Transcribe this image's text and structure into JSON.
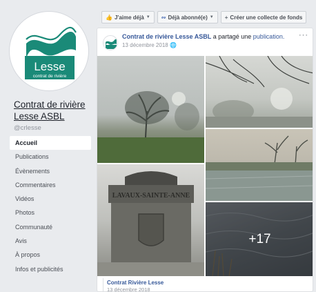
{
  "page": {
    "logo_text": "Lesse",
    "logo_subtext": "contrat de rivière",
    "name": "Contrat de rivière Lesse ASBL",
    "handle": "@crlesse"
  },
  "nav": {
    "items": [
      {
        "label": "Accueil",
        "active": true
      },
      {
        "label": "Publications"
      },
      {
        "label": "Évènements"
      },
      {
        "label": "Commentaires"
      },
      {
        "label": "Vidéos"
      },
      {
        "label": "Photos"
      },
      {
        "label": "Communauté"
      },
      {
        "label": "Avis"
      },
      {
        "label": "À propos"
      },
      {
        "label": "Infos et publicités"
      }
    ]
  },
  "topbar": {
    "like_label": "J'aime déjà",
    "follow_label": "Déjà abonné(e)",
    "fundraiser_label": "Créer une collecte de fonds"
  },
  "post": {
    "author": "Contrat de rivière Lesse ASBL",
    "action": "a partagé une",
    "object": "publication.",
    "date": "13 décembre 2018",
    "more_label": "···",
    "photos_more": "+17",
    "shared_author": "Contrat Rivière Lesse",
    "shared_date": "13 décembre 2018",
    "stone_inscription": "LAVAUX-SAINTE-ANNE"
  },
  "colors": {
    "brand_teal": "#1a8a78",
    "link_blue": "#365899",
    "fb_blue": "#4267b2"
  }
}
